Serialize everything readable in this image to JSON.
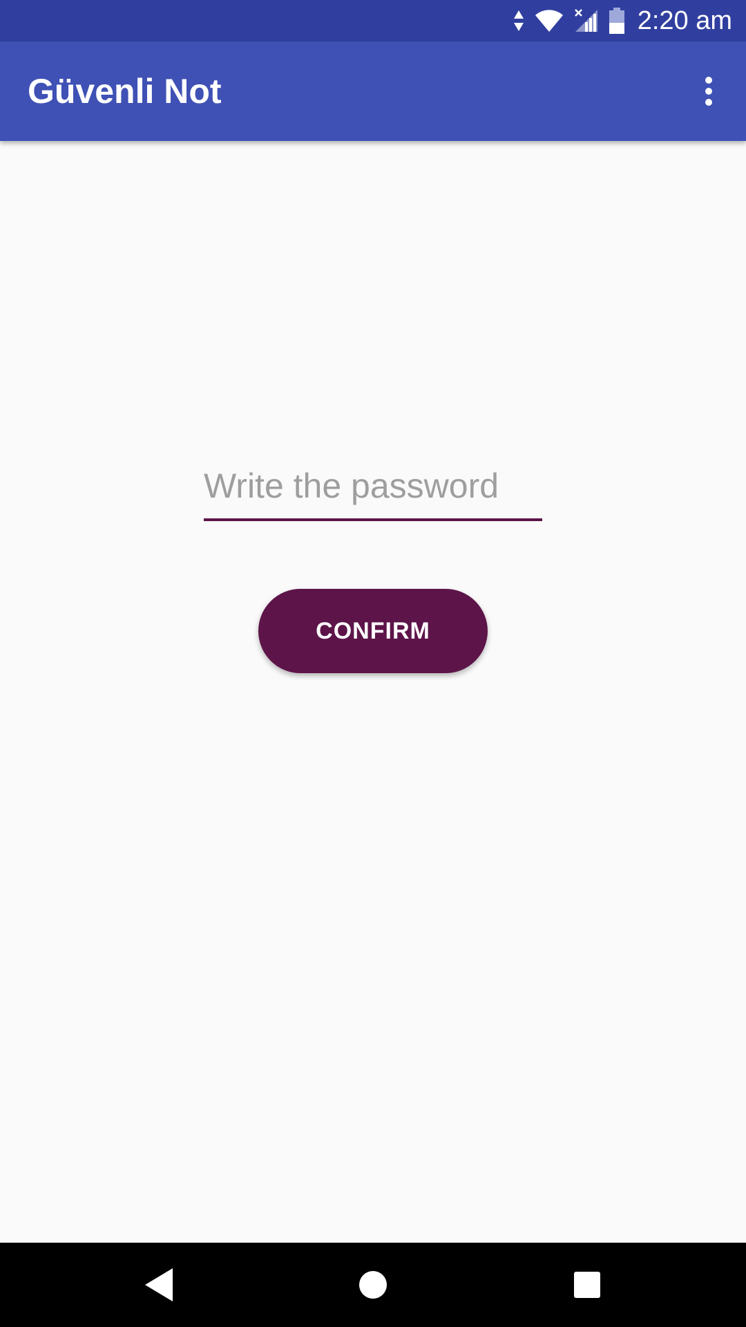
{
  "status_bar": {
    "time": "2:20 am",
    "icons": [
      "data-activity-icon",
      "wifi-icon",
      "cell-signal-no-data-icon",
      "battery-icon"
    ]
  },
  "app_bar": {
    "title": "Güvenli Not",
    "menu_icon": "overflow-menu-icon"
  },
  "form": {
    "password_placeholder": "Write the password",
    "password_value": "",
    "confirm_label": "CONFIRM"
  },
  "nav_bar": {
    "icons": [
      "back-icon",
      "home-icon",
      "recents-icon"
    ]
  },
  "colors": {
    "status_bar": "#303f9f",
    "app_bar": "#3f51b5",
    "accent": "#5d1449",
    "background": "#fafafa"
  }
}
